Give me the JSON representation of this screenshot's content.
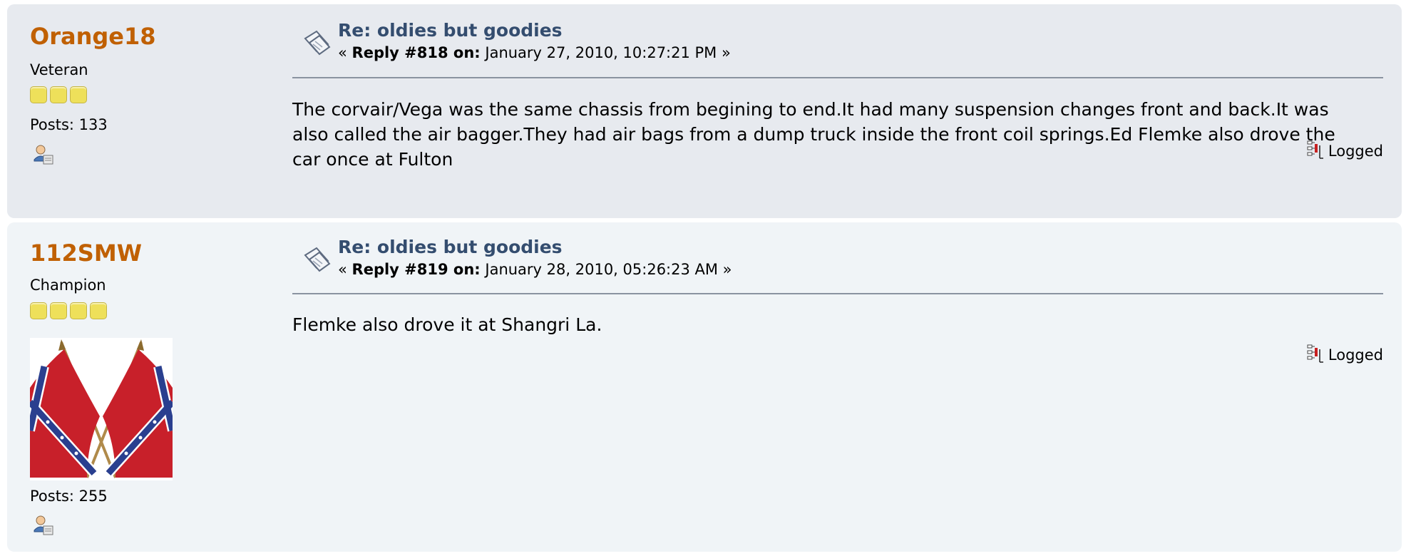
{
  "posts": [
    {
      "username": "Orange18",
      "rank": "Veteran",
      "stars": 3,
      "posts_label": "Posts: 133",
      "subject": "Re: oldies but goodies",
      "meta_prefix": "« ",
      "reply_label": "Reply #818 on:",
      "date": " January 27, 2010, 10:27:21 PM »",
      "body": "The corvair/Vega was the same chassis from begining to end.It had many suspension changes front and back.It was also called the air bagger.They had air bags from a dump truck inside the front coil springs.Ed Flemke also drove the car once at Fulton",
      "logged_label": "Logged"
    },
    {
      "username": "112SMW",
      "rank": "Champion",
      "stars": 4,
      "posts_label": "Posts: 255",
      "subject": "Re: oldies but goodies",
      "meta_prefix": "« ",
      "reply_label": "Reply #819 on:",
      "date": " January 28, 2010, 05:26:23 AM »",
      "body": "Flemke also drove it at Shangri La.",
      "logged_label": "Logged"
    }
  ],
  "icons": {
    "topic": "topic-icon",
    "profile": "profile-icon",
    "logged": "ip-logged-icon"
  },
  "colors": {
    "username": "#c06002",
    "subject": "#344d6f",
    "post1_bg": "#e7eaef",
    "post2_bg": "#f0f4f7"
  }
}
